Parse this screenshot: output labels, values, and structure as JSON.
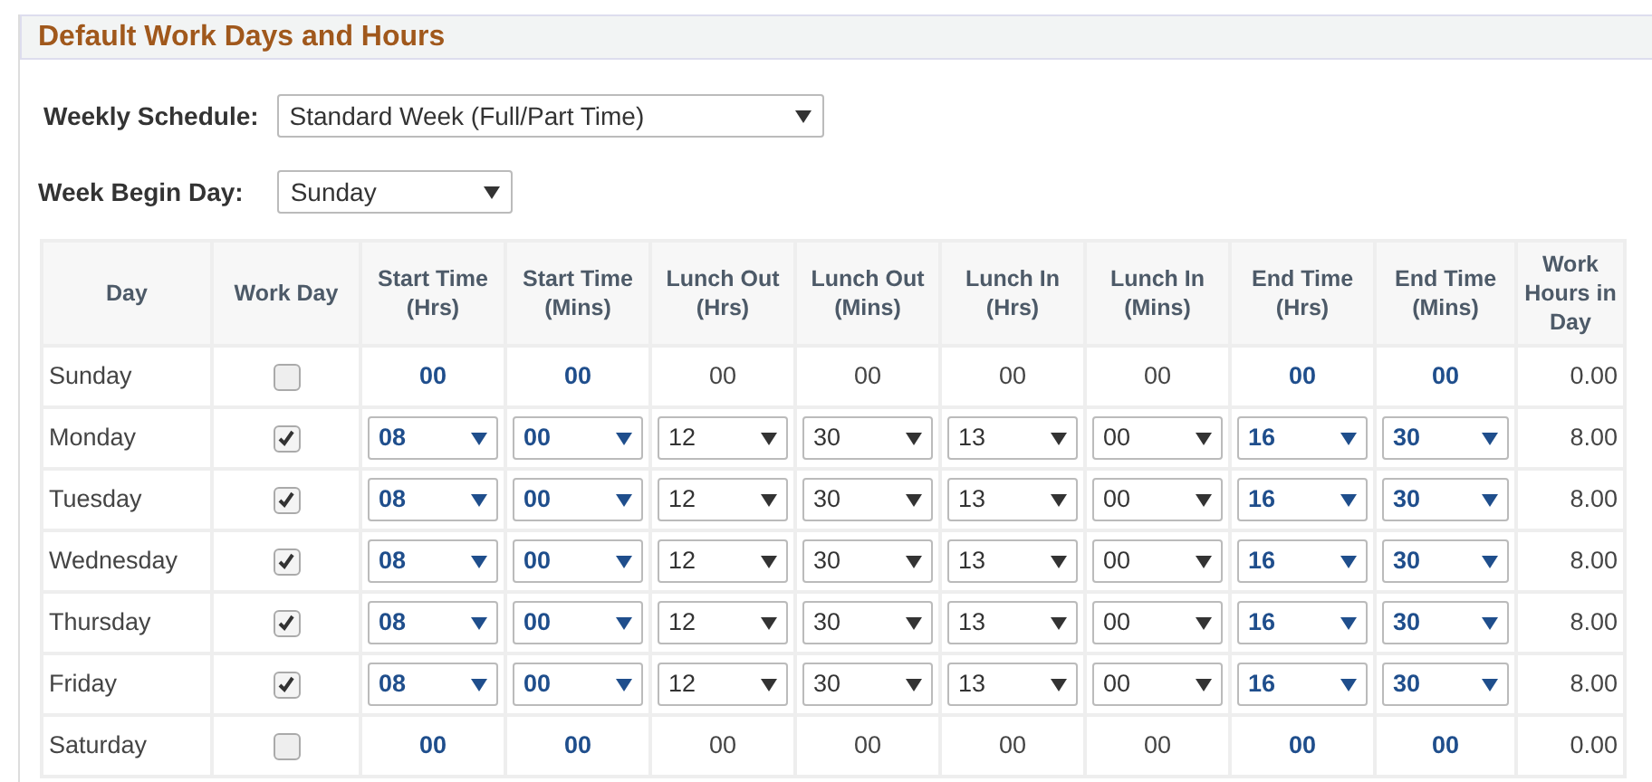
{
  "section": {
    "title": "Default Work Days and Hours"
  },
  "weekly_schedule": {
    "label": "Weekly Schedule:",
    "value": "Standard Week (Full/Part Time)"
  },
  "week_begin_day": {
    "label": "Week Begin Day:",
    "value": "Sunday"
  },
  "table": {
    "columns": [
      {
        "label": "Day",
        "bold": false
      },
      {
        "label": "Work Day",
        "bold": false
      },
      {
        "label": "Start Time (Hrs)",
        "bold": true
      },
      {
        "label": "Start Time (Mins)",
        "bold": true
      },
      {
        "label": "Lunch Out (Hrs)",
        "bold": false
      },
      {
        "label": "Lunch Out (Mins)",
        "bold": false
      },
      {
        "label": "Lunch In (Hrs)",
        "bold": false
      },
      {
        "label": "Lunch In (Mins)",
        "bold": false
      },
      {
        "label": "End Time (Hrs)",
        "bold": true
      },
      {
        "label": "End Time (Mins)",
        "bold": true
      },
      {
        "label": "Work Hours in Day",
        "bold": false
      }
    ],
    "rows": [
      {
        "day": "Sunday",
        "work_day": false,
        "times": [
          "00",
          "00",
          "00",
          "00",
          "00",
          "00",
          "00",
          "00"
        ],
        "hours": "0.00"
      },
      {
        "day": "Monday",
        "work_day": true,
        "times": [
          "08",
          "00",
          "12",
          "30",
          "13",
          "00",
          "16",
          "30"
        ],
        "hours": "8.00"
      },
      {
        "day": "Tuesday",
        "work_day": true,
        "times": [
          "08",
          "00",
          "12",
          "30",
          "13",
          "00",
          "16",
          "30"
        ],
        "hours": "8.00"
      },
      {
        "day": "Wednesday",
        "work_day": true,
        "times": [
          "08",
          "00",
          "12",
          "30",
          "13",
          "00",
          "16",
          "30"
        ],
        "hours": "8.00"
      },
      {
        "day": "Thursday",
        "work_day": true,
        "times": [
          "08",
          "00",
          "12",
          "30",
          "13",
          "00",
          "16",
          "30"
        ],
        "hours": "8.00"
      },
      {
        "day": "Friday",
        "work_day": true,
        "times": [
          "08",
          "00",
          "12",
          "30",
          "13",
          "00",
          "16",
          "30"
        ],
        "hours": "8.00"
      },
      {
        "day": "Saturday",
        "work_day": false,
        "times": [
          "00",
          "00",
          "00",
          "00",
          "00",
          "00",
          "00",
          "00"
        ],
        "hours": "0.00"
      }
    ]
  }
}
